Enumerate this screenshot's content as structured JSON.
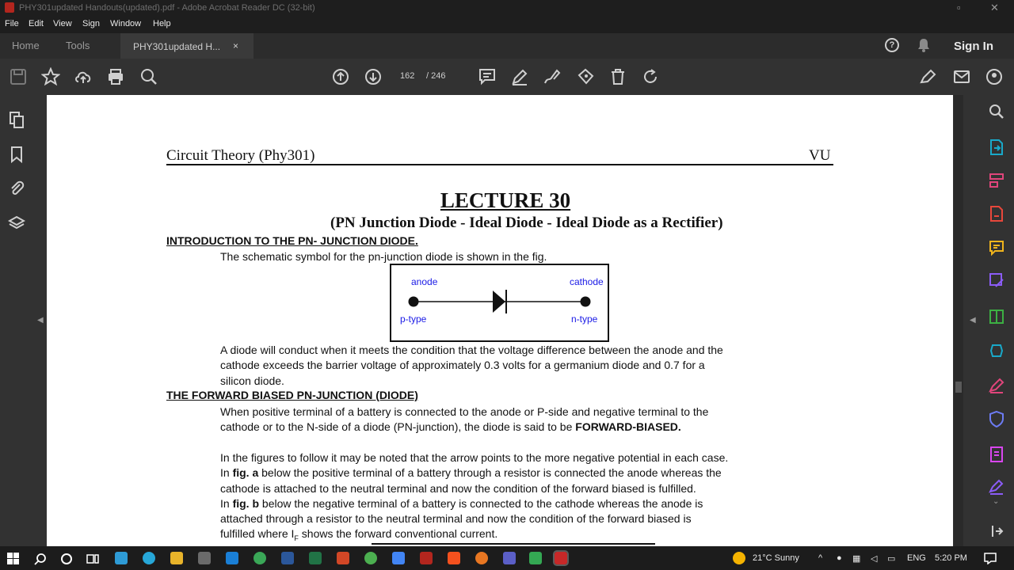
{
  "window": {
    "title": "PHY301updated Handouts(updated).pdf - Adobe Acrobat Reader DC (32-bit)"
  },
  "menu": [
    "File",
    "Edit",
    "View",
    "Sign",
    "Window",
    "Help"
  ],
  "tabs": {
    "home": "Home",
    "tools": "Tools",
    "doc": "PHY301updated H...",
    "close": "×"
  },
  "account": {
    "sign_in": "Sign In"
  },
  "nav": {
    "page": "162",
    "total": "/ 246"
  },
  "doc": {
    "header_left": "Circuit Theory (Phy301)",
    "header_right": "VU",
    "lecture": "LECTURE 30",
    "subtitle": "(PN Junction Diode - Ideal Diode - Ideal Diode as a Rectifier)",
    "sec1": "INTRODUCTION TO THE PN-  JUNCTION DIODE.",
    "p1": "The schematic symbol for the pn-junction diode is shown in the fig.",
    "diagram": {
      "anode": "anode",
      "cathode": "cathode",
      "ptype": "p-type",
      "ntype": "n-type"
    },
    "p2_l1": "A diode will conduct when it meets the condition that the voltage difference between the anode and the",
    "p2_l2": "cathode exceeds the barrier voltage of approximately 0.3 volts for a germanium diode and 0.7 for a",
    "p2_l3": "silicon diode.",
    "sec2": "THE FORWARD BIASED PN-JUNCTION (DIODE)",
    "p3_l1": "When positive terminal of a battery is connected to the anode or P-side and negative terminal to the",
    "p3_l2a": "cathode or to the N-side of a diode (PN-junction), the diode is said to be ",
    "p3_l2b": "FORWARD-BIASED.",
    "p4_l1": "In the figures to follow it may be noted that the arrow points to the more negative potential in each case.",
    "p4_l2a": "In ",
    "p4_l2b": "fig. a",
    "p4_l2c": " below the positive terminal of a battery through a resistor is connected the anode whereas the",
    "p4_l3": "cathode is attached to the neutral terminal and now the condition of the forward biased is fulfilled.",
    "p4_l4a": "In ",
    "p4_l4b": "fig. b",
    "p4_l4c": " below the negative terminal of a battery is connected to  the cathode whereas the anode is",
    "p4_l5": "attached through a resistor to the neutral terminal and now the condition of the forward biased is",
    "p4_l6a": "fulfilled where I",
    "p4_l6sub": "F",
    "p4_l6b": " shows the forward conventional current."
  },
  "taskbar": {
    "weather": "21°C  Sunny",
    "lang": "ENG",
    "time": "5:20 PM"
  },
  "colors": {
    "accent_red": "#b3261e",
    "diagram_label": "#1a1ae6"
  }
}
